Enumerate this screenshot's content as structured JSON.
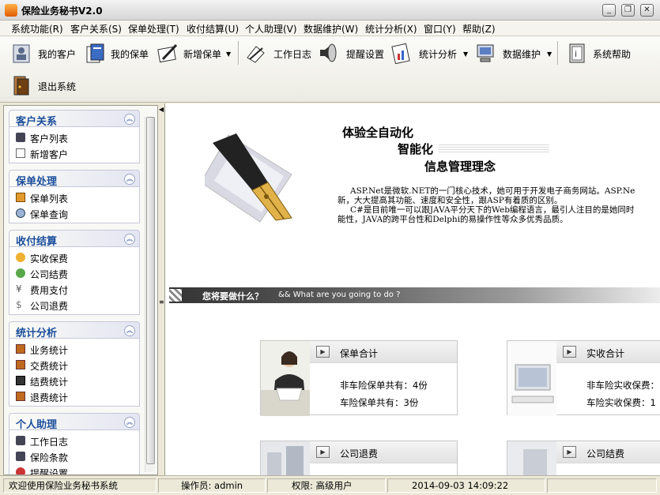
{
  "window": {
    "title": "保险业务秘书V2.0",
    "controls": [
      "minimize",
      "restore",
      "close"
    ]
  },
  "menu": [
    "系统功能(R)",
    "客户关系(S)",
    "保单处理(T)",
    "收付结算(U)",
    "个人助理(V)",
    "数据维护(W)",
    "统计分析(X)",
    "窗口(Y)",
    "帮助(Z)"
  ],
  "toolbar": {
    "my_customers": "我的客户",
    "my_policies": "我的保单",
    "new_policy": "新增保单",
    "work_log": "工作日志",
    "reminder_settings": "提醒设置",
    "statistics": "统计分析",
    "data_maintenance": "数据维护",
    "system_help": "系统帮助",
    "exit": "退出系统"
  },
  "sidebar": {
    "panels": [
      {
        "title": "客户关系",
        "items": [
          "客户列表",
          "新增客户"
        ]
      },
      {
        "title": "保单处理",
        "items": [
          "保单列表",
          "保单查询"
        ]
      },
      {
        "title": "收付结算",
        "items": [
          "实收保费",
          "公司结费",
          "费用支付",
          "公司退费"
        ]
      },
      {
        "title": "统计分析",
        "items": [
          "业务统计",
          "交费统计",
          "结费统计",
          "退费统计"
        ]
      },
      {
        "title": "个人助理",
        "items": [
          "工作日志",
          "保险条款",
          "提醒设置"
        ]
      }
    ]
  },
  "main": {
    "slogan": {
      "line1": "体验全自动化",
      "line2": "智能化",
      "line3": "信息管理理念"
    },
    "description": {
      "line1": "ASP.Net是微软.NET的一门核心技术，她可用于开发电子商务网站。ASP.Ne",
      "line2": "新，大大提高其功能、速度和安全性，跟ASP有着质的区别。",
      "line3": "C#是目前唯一可以跟JAVA平分天下的Web编程语言，最引人注目的是她同时",
      "line4": "能性，JAVA的跨平台性和Delphi的易操作性等众多优秀品质。"
    },
    "banner": {
      "cn": "您将要做什么？",
      "en": "&& What are you going to do ?"
    },
    "cards": [
      {
        "title": "保单合计",
        "line1": "非车险保单共有：4份",
        "line2": "车险保单共有：3份"
      },
      {
        "title": "实收合计",
        "line1": "非车险实收保费：",
        "line2": "车险实收保费：1"
      },
      {
        "title": "公司退费"
      },
      {
        "title": "公司结费"
      }
    ]
  },
  "status": {
    "welcome": "欢迎使用保险业务秘书系统",
    "operator": "操作员: admin",
    "permission": "权限: 高级用户",
    "datetime": "2014-09-03 14:09:22"
  },
  "colors": {
    "panel_header_text": "#1b4e9b",
    "banner_dark": "#333333",
    "window_bg": "#ece9d8"
  }
}
